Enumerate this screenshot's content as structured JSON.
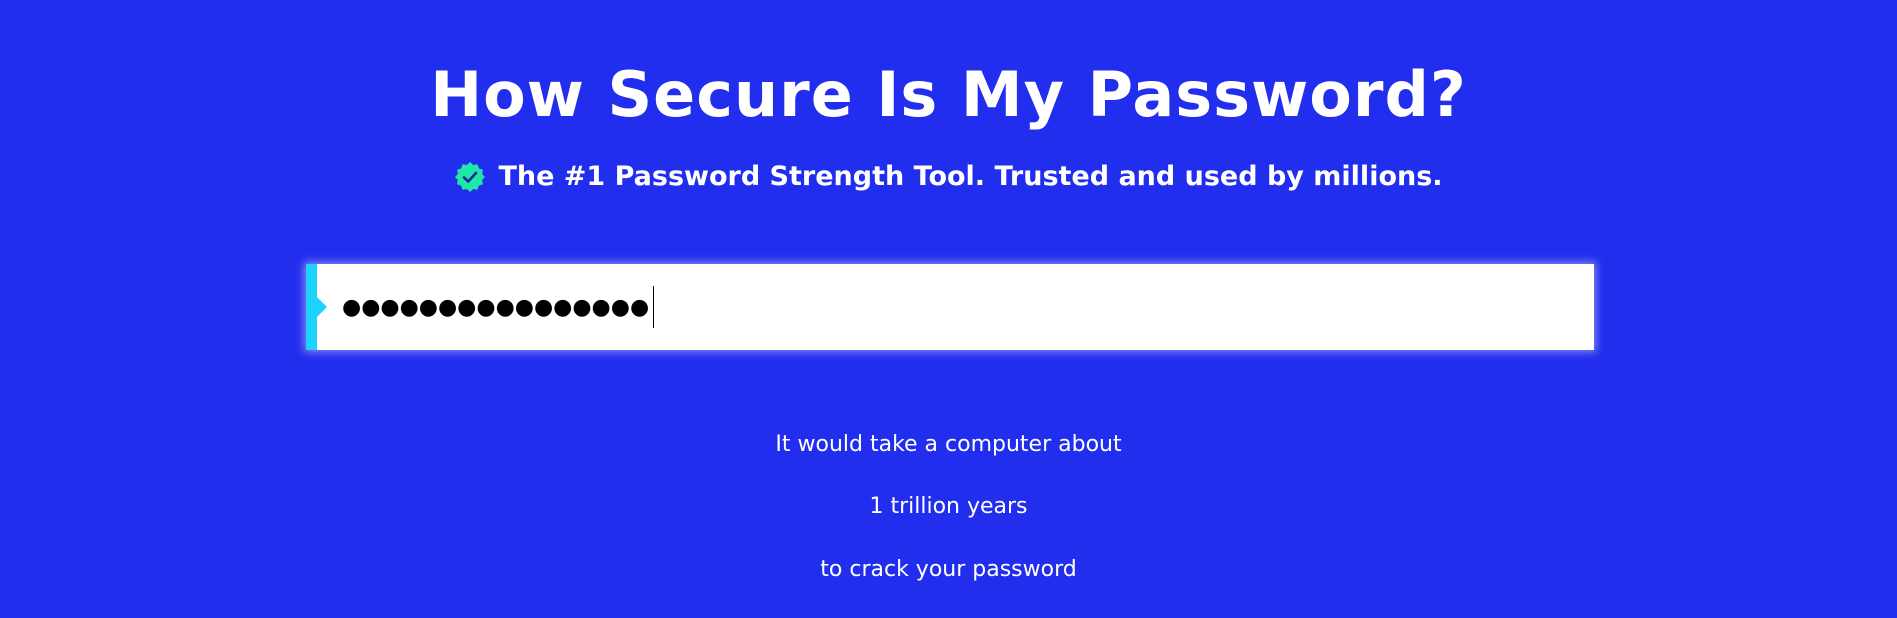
{
  "header": {
    "title": "How Secure Is My Password?",
    "subtitle": "The #1 Password Strength Tool. Trusted and used by millions.",
    "badge_icon": "verified-check-badge-icon",
    "badge_color": "#21e6a8"
  },
  "password_field": {
    "masked_value": "●●●●●●●●●●●●●●●●",
    "accent_color": "#1fd3ff"
  },
  "result": {
    "line_1": "It would take a computer about",
    "line_2": "1 trillion years",
    "line_3": "to crack your password"
  },
  "colors": {
    "background": "#222eed",
    "text": "#ffffff"
  }
}
